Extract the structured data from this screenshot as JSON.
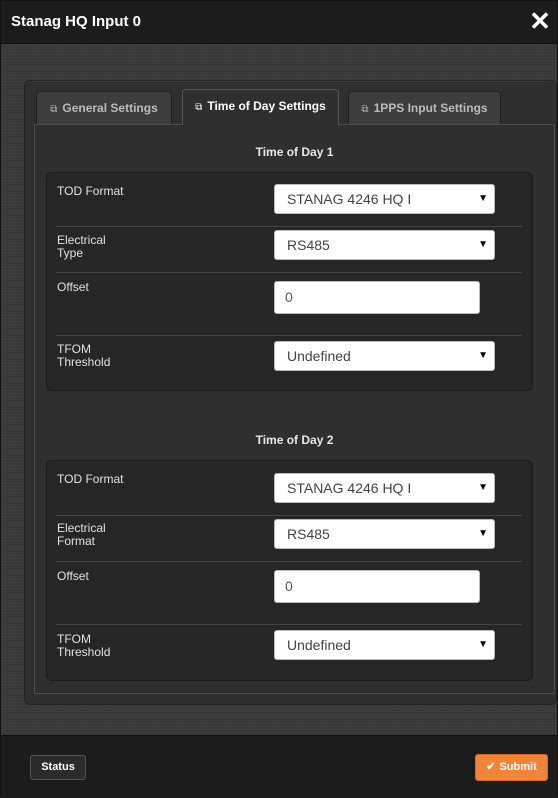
{
  "dialog": {
    "title": "Stanag HQ Input 0",
    "close_symbol": "✕"
  },
  "tabs": [
    {
      "label": "General Settings",
      "icon": "window-icon",
      "icon_glyph": "⧉",
      "active": false
    },
    {
      "label": "Time of Day Settings",
      "icon": "window-icon",
      "icon_glyph": "⧉",
      "active": true
    },
    {
      "label": "1PPS Input Settings",
      "icon": "window-icon",
      "icon_glyph": "⧉",
      "active": false
    }
  ],
  "tod1": {
    "heading": "Time of Day 1",
    "tod_format_label": "TOD Format",
    "tod_format_value": "STANAG 4246 HQ I",
    "electrical_label": "Electrical\nType",
    "electrical_value": "RS485",
    "offset_label": "Offset",
    "offset_value": "0",
    "tfom_label": "TFOM\nThreshold",
    "tfom_value": "Undefined"
  },
  "tod2": {
    "heading": "Time of Day 2",
    "tod_format_label": "TOD Format",
    "tod_format_value": "STANAG 4246 HQ I",
    "electrical_label": "Electrical\nFormat",
    "electrical_value": "RS485",
    "offset_label": "Offset",
    "offset_value": "0",
    "tfom_label": "TFOM\nThreshold",
    "tfom_value": "Undefined"
  },
  "select_arrow": "▼",
  "footer": {
    "status_label": "Status",
    "submit_label": "Submit",
    "submit_icon_glyph": "✔"
  },
  "colors": {
    "accent": "#f0843a",
    "titlebar": "#1c1c1c",
    "panel": "#2f2f2f"
  }
}
